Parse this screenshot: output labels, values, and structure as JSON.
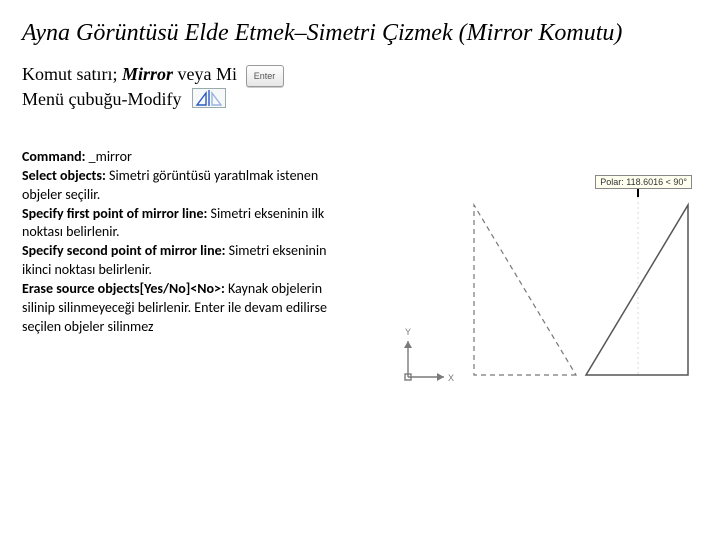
{
  "title": "Ayna Görüntüsü Elde Etmek–Simetri Çizmek (Mirror Komutu)",
  "instr": {
    "line1_prefix": "Komut satırı; ",
    "mirror": "Mirror",
    "veya": " veya ",
    "mi": "Mi",
    "line2": "Menü çubuğu-Modify",
    "enter_label": "Enter"
  },
  "cmd": {
    "l1b": "Command:",
    "l1t": " _mirror",
    "l2b": "Select objects:",
    "l2t": " Simetri görüntüsü yaratılmak istenen objeler seçilir.",
    "l3b": "Specify first point of mirror line:",
    "l3t": " Simetri ekseninin ilk noktası belirlenir.",
    "l4b": "Specify second point of mirror line:",
    "l4t": " Simetri ekseninin ikinci noktası belirlenir.",
    "l5b": "Erase source objects[Yes/No]<No>:",
    "l5t": " Kaynak objelerin silinip silinmeyeceği belirlenir. Enter ile devam edilirse seçilen objeler silinmez"
  },
  "figure": {
    "polar_tip": "Polar: 118.6016 < 90°",
    "axis_y": "Y",
    "axis_x": "X"
  }
}
